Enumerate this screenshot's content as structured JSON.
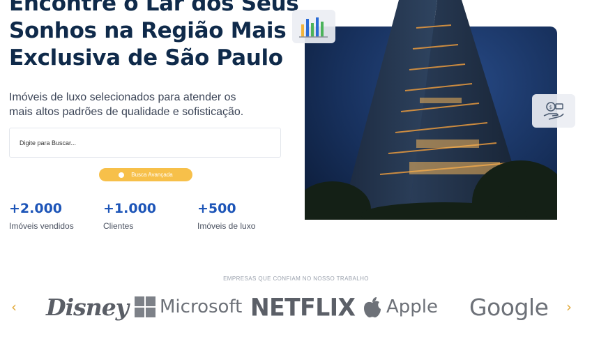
{
  "hero": {
    "headline_lines": [
      "Encontre o Lar dos Seus",
      "Sonhos na Região Mais",
      "Exclusiva de São Paulo"
    ],
    "subtitle": "Imóveis de luxo selecionados para atender os mais altos padrões de qualidade e sofisticação.",
    "search": {
      "placeholder": "Digite para Buscar..."
    },
    "advanced_search_label": "Busca Avançada"
  },
  "stats": [
    {
      "value": "+2.000",
      "label": "Imóveis vendidos"
    },
    {
      "value": "+1.000",
      "label": "Clientes"
    },
    {
      "value": "+500",
      "label": "Imóveis de luxo"
    }
  ],
  "media": {
    "image": "luxury-tower-night",
    "chips": [
      "bar-chart-icon",
      "money-hand-icon"
    ]
  },
  "partners": {
    "title": "EMPRESAS QUE CONFIAM NO NOSSO TRABALHO",
    "logos": [
      "Disney",
      "Microsoft",
      "NETFLIX",
      "Apple",
      "Google"
    ],
    "prev_icon": "chevron-left-icon",
    "next_icon": "chevron-right-icon"
  },
  "colors": {
    "headline": "#0f2a4a",
    "stat_number": "#1d55b8",
    "accent_button": "#f7c04a",
    "photo_sky": "#17305c",
    "arrow": "#e1a93a",
    "logo_gray": "#6d7178"
  }
}
